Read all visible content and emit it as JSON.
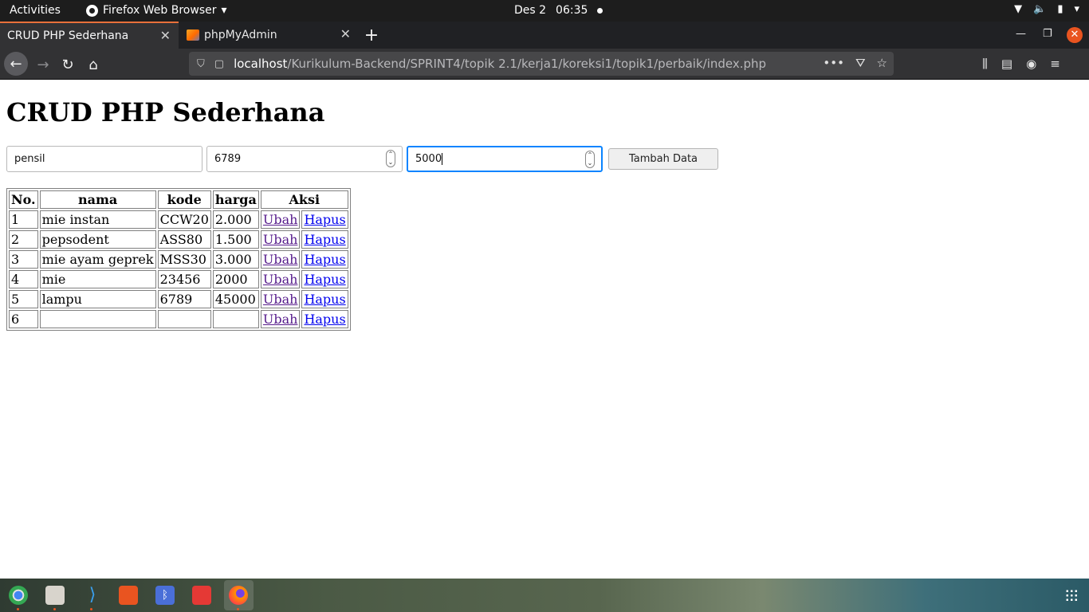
{
  "topbar": {
    "activities": "Activities",
    "app_menu": "Firefox Web Browser",
    "date": "Des 2",
    "time": "06:35"
  },
  "tabs": [
    {
      "label": "CRUD PHP Sederhana",
      "active": true
    },
    {
      "label": "phpMyAdmin",
      "active": false
    }
  ],
  "url": {
    "host": "localhost",
    "path": "/Kurikulum-Backend/SPRINT4/topik 2.1/kerja1/koreksi1/topik1/perbaik/index.php"
  },
  "page": {
    "title": "CRUD PHP Sederhana",
    "form": {
      "nama_value": "pensil",
      "kode_value": "6789",
      "harga_value": "5000",
      "submit_label": "Tambah Data"
    },
    "table": {
      "headers": [
        "No.",
        "nama",
        "kode",
        "harga",
        "Aksi"
      ],
      "rows": [
        {
          "no": "1",
          "nama": "mie instan",
          "kode": "CCW20",
          "harga": "2.000"
        },
        {
          "no": "2",
          "nama": "pepsodent",
          "kode": "ASS80",
          "harga": "1.500"
        },
        {
          "no": "3",
          "nama": "mie ayam geprek",
          "kode": "MSS30",
          "harga": "3.000"
        },
        {
          "no": "4",
          "nama": "mie",
          "kode": "23456",
          "harga": "2000"
        },
        {
          "no": "5",
          "nama": "lampu",
          "kode": "6789",
          "harga": "45000"
        },
        {
          "no": "6",
          "nama": "",
          "kode": "",
          "harga": ""
        }
      ],
      "edit_label": "Ubah",
      "delete_label": "Hapus"
    }
  },
  "colors": {
    "accent": "#e95420",
    "link": "#0000ee",
    "visited_link": "#551a8b",
    "focus_ring": "#0a84ff"
  }
}
